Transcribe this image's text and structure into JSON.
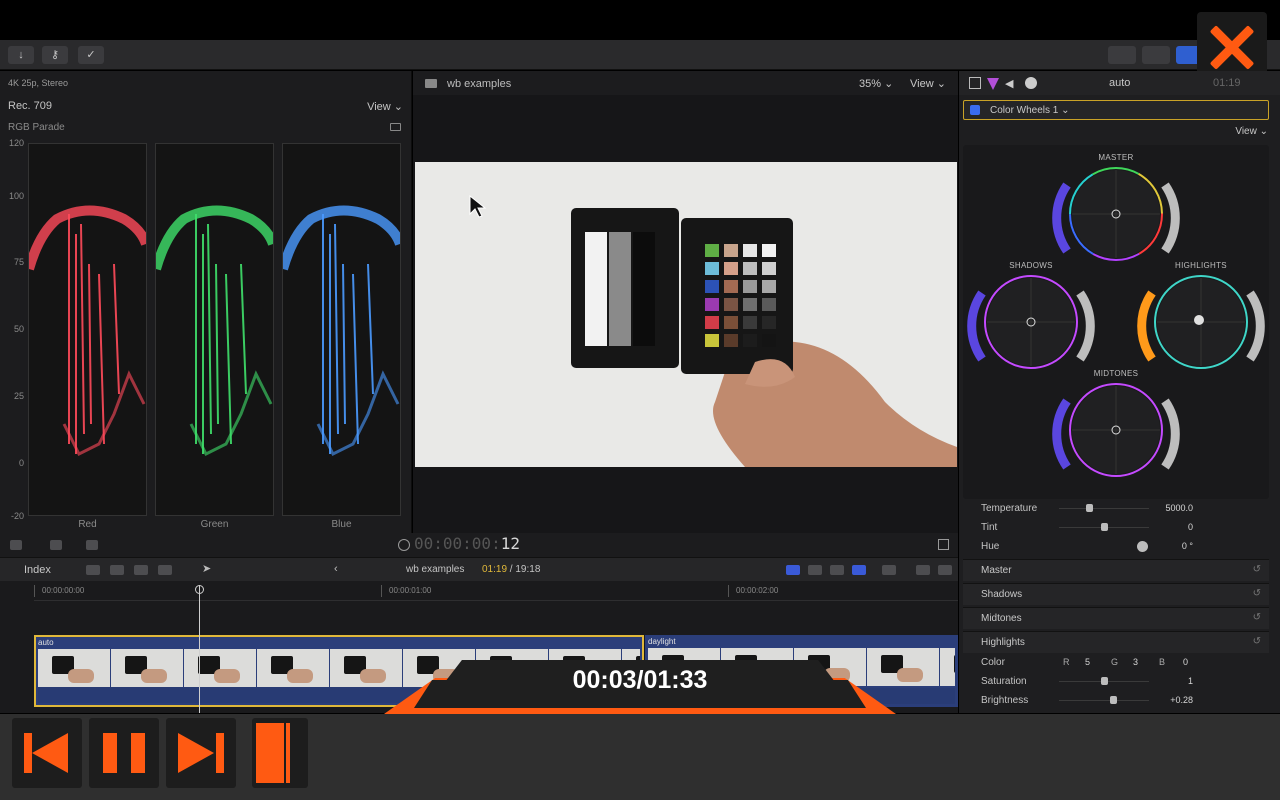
{
  "topbar": {
    "close_label": "×"
  },
  "scopes": {
    "format": "4K 25p, Stereo",
    "rec": "Rec. 709",
    "view": "View",
    "subtitle": "RGB Parade",
    "axis": [
      "120",
      "100",
      "75",
      "50",
      "25",
      "0",
      "-20"
    ],
    "channels": [
      {
        "name": "Red",
        "color": "#ff4a5a"
      },
      {
        "name": "Green",
        "color": "#3fe06a"
      },
      {
        "name": "Blue",
        "color": "#4a9aff"
      }
    ]
  },
  "viewer": {
    "title": "wb examples",
    "zoom": "35%",
    "view": "View",
    "timecode_dim": "00:00:00:",
    "timecode_frame": "12"
  },
  "inspector": {
    "clip_name": "auto",
    "timecode": "01:19",
    "effect": "Color Wheels 1",
    "view": "View",
    "wheels": [
      {
        "label": "MASTER"
      },
      {
        "label": "SHADOWS"
      },
      {
        "label": "HIGHLIGHTS"
      },
      {
        "label": "MIDTONES"
      }
    ],
    "sliders": [
      {
        "label": "Temperature",
        "value": "5000.0",
        "level": 0.33
      },
      {
        "label": "Tint",
        "value": "0",
        "level": 0.5
      },
      {
        "label": "Hue",
        "value": "0 °",
        "level": 0.9
      }
    ],
    "sections": [
      "Master",
      "Shadows",
      "Midtones",
      "Highlights"
    ],
    "color_row": {
      "label": "Color",
      "r_label": "R",
      "r": "5",
      "g_label": "G",
      "g": "3",
      "b_label": "B",
      "b": "0"
    },
    "saturation": {
      "label": "Saturation",
      "value": "1",
      "level": 0.5
    },
    "brightness": {
      "label": "Brightness",
      "value": "+0.28",
      "level": 0.6
    }
  },
  "timeline": {
    "index": "Index",
    "project": "wb examples",
    "position": "01:19",
    "duration": "19:18",
    "ruler": [
      "00:00:00:00",
      "00:00:01:00",
      "00:00:02:00"
    ],
    "clips": [
      {
        "name": "auto"
      },
      {
        "name": "daylight"
      }
    ]
  },
  "player": {
    "time": "00:03/01:33",
    "progress": 0.03
  }
}
